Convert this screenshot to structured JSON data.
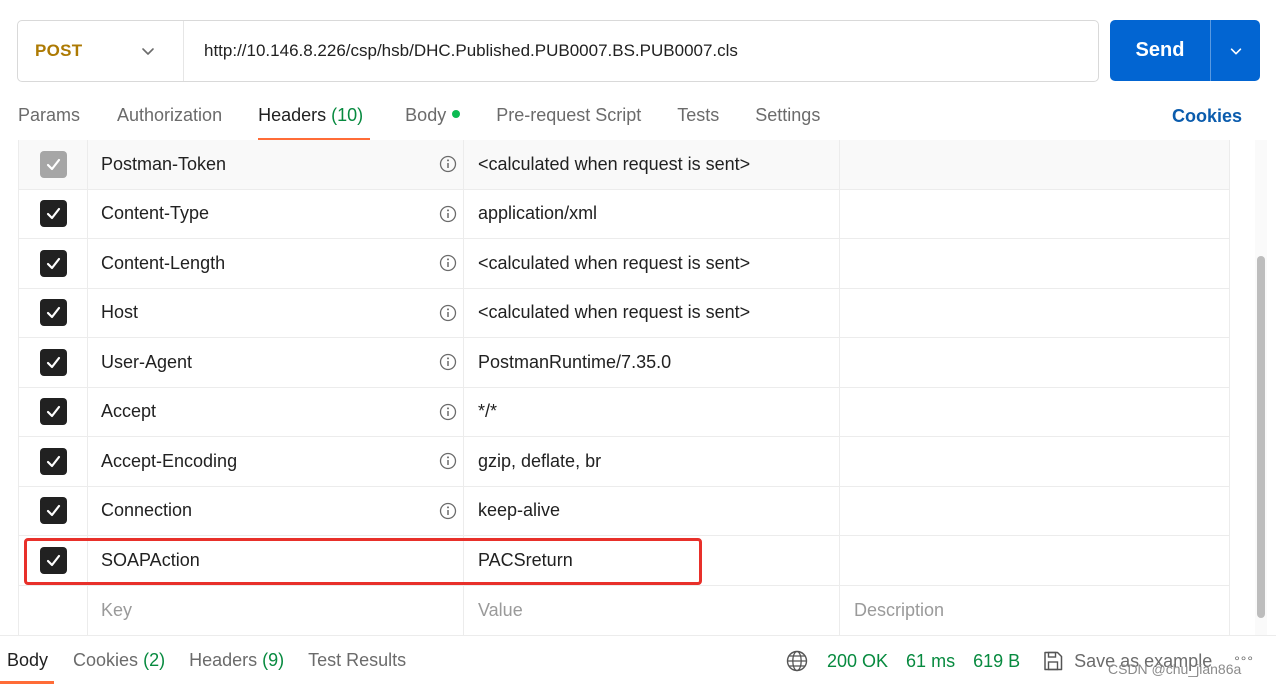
{
  "request": {
    "method": "POST",
    "url": "http://10.146.8.226/csp/hsb/DHC.Published.PUB0007.BS.PUB0007.cls",
    "send_label": "Send"
  },
  "tabs": {
    "params": "Params",
    "authorization": "Authorization",
    "headers_label": "Headers",
    "headers_count": "(10)",
    "body": "Body",
    "pre_request": "Pre-request Script",
    "tests": "Tests",
    "settings": "Settings",
    "cookies": "Cookies"
  },
  "headers": [
    {
      "key": "Postman-Token",
      "value": "<calculated when request is sent>"
    },
    {
      "key": "Content-Type",
      "value": "application/xml"
    },
    {
      "key": "Content-Length",
      "value": "<calculated when request is sent>"
    },
    {
      "key": "Host",
      "value": "<calculated when request is sent>"
    },
    {
      "key": "User-Agent",
      "value": "PostmanRuntime/7.35.0"
    },
    {
      "key": "Accept",
      "value": "*/*"
    },
    {
      "key": "Accept-Encoding",
      "value": "gzip, deflate, br"
    },
    {
      "key": "Connection",
      "value": "keep-alive"
    },
    {
      "key": "SOAPAction",
      "value": "PACSreturn"
    }
  ],
  "new_row": {
    "key_placeholder": "Key",
    "value_placeholder": "Value",
    "description_placeholder": "Description"
  },
  "response": {
    "tabs": {
      "body": "Body",
      "cookies_label": "Cookies",
      "cookies_count": "(2)",
      "headers_label": "Headers",
      "headers_count": "(9)",
      "test_results": "Test Results"
    },
    "status": "200 OK",
    "time": "61 ms",
    "size": "619 B",
    "save_label": "Save as example",
    "more": "°°°"
  },
  "watermark": "CSDN @chu_jian86a",
  "colors": {
    "accent": "#ff6c37",
    "send_blue": "#0265d2",
    "method_post": "#ad7a03",
    "status_green": "#078a3f",
    "highlight": "#e8302a"
  }
}
